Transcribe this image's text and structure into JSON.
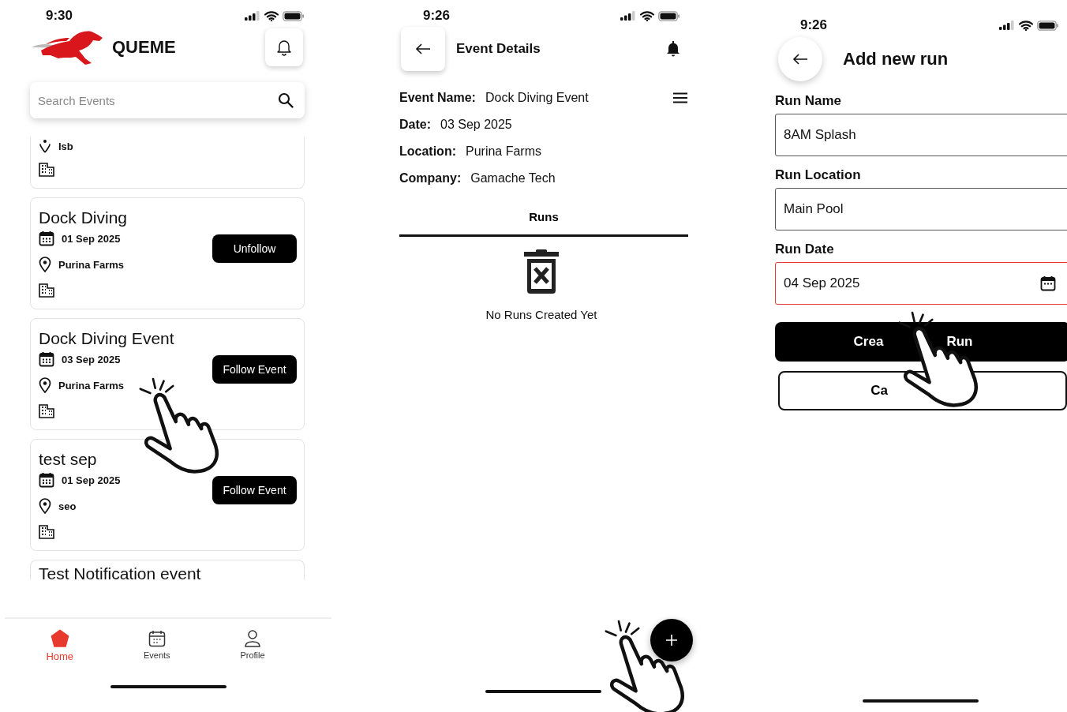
{
  "home_screen": {
    "status_time": "9:30",
    "app_name": "QUEME",
    "search": {
      "placeholder": "Search Events"
    },
    "events": [
      {
        "kind": "partial_top",
        "location": "Isb"
      },
      {
        "kind": "full",
        "title": "Dock Diving",
        "date": "01 Sep 2025",
        "location": "Purina Farms",
        "button": "Unfollow"
      },
      {
        "kind": "full",
        "title": "Dock Diving Event",
        "date": "03 Sep 2025",
        "location": "Purina Farms",
        "button": "Follow Event"
      },
      {
        "kind": "full",
        "title": "test sep",
        "date": "01 Sep 2025",
        "location": "seo",
        "button": "Follow Event"
      },
      {
        "kind": "partial_bottom",
        "title": "Test Notification event"
      }
    ],
    "nav": [
      {
        "label": "Home",
        "selected": true
      },
      {
        "label": "Events",
        "selected": false
      },
      {
        "label": "Profile",
        "selected": false
      }
    ]
  },
  "event_details_screen": {
    "status_time": "9:26",
    "title": "Event Details",
    "fields": [
      {
        "label": "Event Name:",
        "value": "Dock Diving Event"
      },
      {
        "label": "Date:",
        "value": "03 Sep 2025"
      },
      {
        "label": "Location:",
        "value": "Purina Farms"
      },
      {
        "label": "Company:",
        "value": "Gamache Tech"
      }
    ],
    "tabs": [
      {
        "label": "Runs",
        "selected": true
      }
    ],
    "empty_message": "No Runs Created Yet"
  },
  "add_run_screen": {
    "status_time": "9:26",
    "title": "Add new run",
    "fields": [
      {
        "label": "Run Name",
        "value": "8AM Splash",
        "kind": "text",
        "invalid": false
      },
      {
        "label": "Run Location",
        "value": "Main Pool",
        "kind": "text",
        "invalid": false
      },
      {
        "label": "Run Date",
        "value": "04 Sep 2025",
        "kind": "date",
        "invalid": true
      }
    ],
    "create_button_parts": [
      "Crea",
      "Run"
    ],
    "cancel_button_visible": "Ca"
  }
}
